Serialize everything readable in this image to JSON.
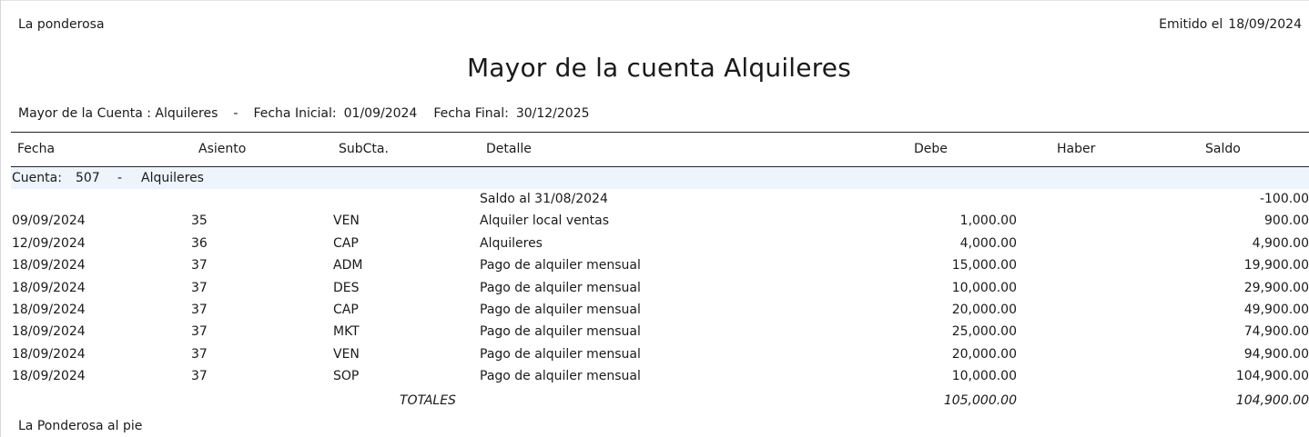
{
  "header": {
    "company": "La ponderosa",
    "issued_label": "Emitido el",
    "issued_date": "18/09/2024"
  },
  "title": "Mayor de la cuenta Alquileres",
  "filters": {
    "account_label": "Mayor de la Cuenta : Alquileres",
    "separator": "-",
    "start_label": "Fecha Inicial:",
    "start_value": "01/09/2024",
    "end_label": "Fecha Final:",
    "end_value": "30/12/2025"
  },
  "table": {
    "columns": [
      "Fecha",
      "Asiento",
      "SubCta.",
      "Detalle",
      "Debe",
      "Haber",
      "Saldo"
    ],
    "account": {
      "label": "Cuenta:",
      "code": "507",
      "separator": "-",
      "name": "Alquileres"
    },
    "rows": [
      {
        "fecha": "",
        "asiento": "",
        "subcta": "",
        "detalle": "Saldo al 31/08/2024",
        "debe": "",
        "haber": "",
        "saldo": "-100.00"
      },
      {
        "fecha": "09/09/2024",
        "asiento": "35",
        "subcta": "VEN",
        "detalle": "Alquiler local ventas",
        "debe": "1,000.00",
        "haber": "",
        "saldo": "900.00"
      },
      {
        "fecha": "12/09/2024",
        "asiento": "36",
        "subcta": "CAP",
        "detalle": "Alquileres",
        "debe": "4,000.00",
        "haber": "",
        "saldo": "4,900.00"
      },
      {
        "fecha": "18/09/2024",
        "asiento": "37",
        "subcta": "ADM",
        "detalle": "Pago de alquiler mensual",
        "debe": "15,000.00",
        "haber": "",
        "saldo": "19,900.00"
      },
      {
        "fecha": "18/09/2024",
        "asiento": "37",
        "subcta": "DES",
        "detalle": "Pago de alquiler mensual",
        "debe": "10,000.00",
        "haber": "",
        "saldo": "29,900.00"
      },
      {
        "fecha": "18/09/2024",
        "asiento": "37",
        "subcta": "CAP",
        "detalle": "Pago de alquiler mensual",
        "debe": "20,000.00",
        "haber": "",
        "saldo": "49,900.00"
      },
      {
        "fecha": "18/09/2024",
        "asiento": "37",
        "subcta": "MKT",
        "detalle": "Pago de alquiler mensual",
        "debe": "25,000.00",
        "haber": "",
        "saldo": "74,900.00"
      },
      {
        "fecha": "18/09/2024",
        "asiento": "37",
        "subcta": "VEN",
        "detalle": "Pago de alquiler mensual",
        "debe": "20,000.00",
        "haber": "",
        "saldo": "94,900.00"
      },
      {
        "fecha": "18/09/2024",
        "asiento": "37",
        "subcta": "SOP",
        "detalle": "Pago de alquiler mensual",
        "debe": "10,000.00",
        "haber": "",
        "saldo": "104,900.00"
      }
    ],
    "totals": {
      "label": "TOTALES",
      "debe": "105,000.00",
      "saldo": "104,900.00"
    }
  },
  "footer": "La Ponderosa al pie"
}
